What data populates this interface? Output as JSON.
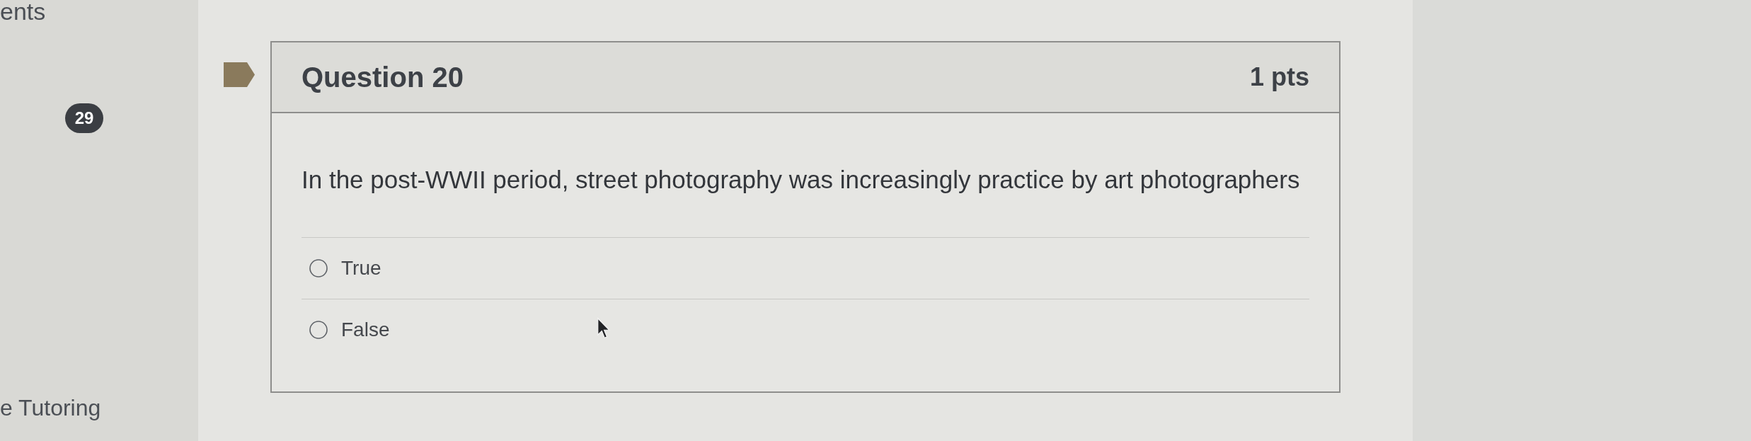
{
  "sidebar": {
    "nav_fragment": "ents",
    "badge": "29",
    "link_fragment": "e Tutoring"
  },
  "question": {
    "title": "Question 20",
    "points": "1 pts",
    "text": "In the post-WWII period, street photography was increasingly practice by art photographers",
    "answers": [
      {
        "label": "True",
        "selected": false
      },
      {
        "label": "False",
        "selected": false
      }
    ]
  }
}
